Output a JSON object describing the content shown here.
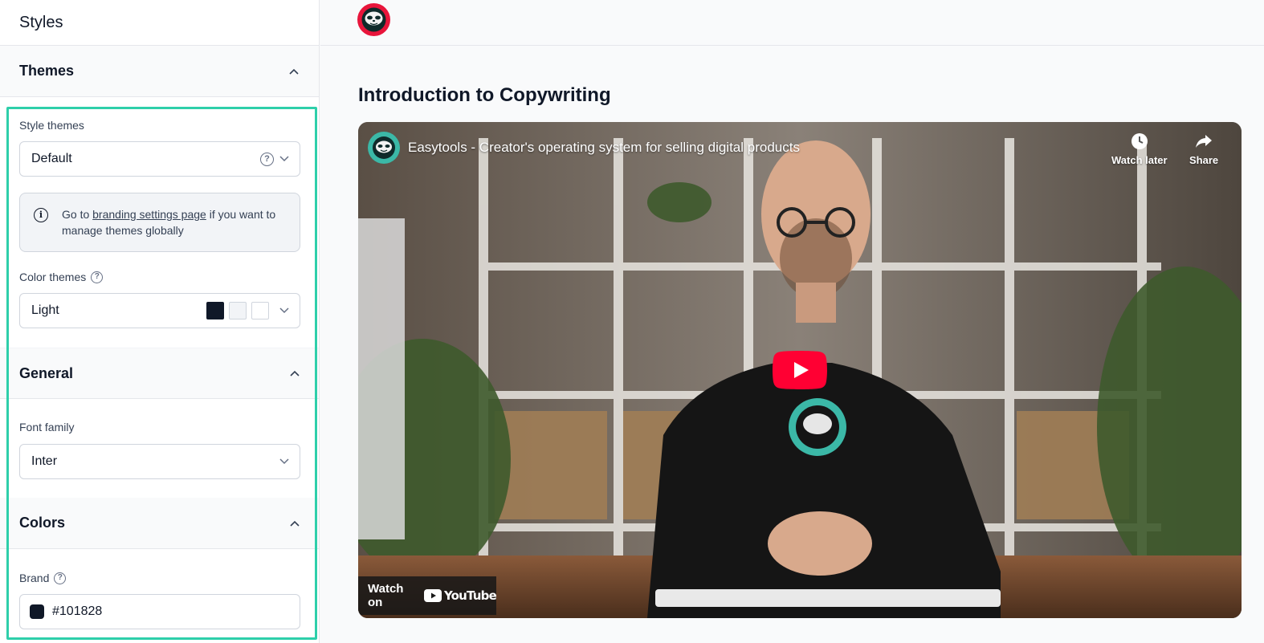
{
  "sidebar": {
    "title": "Styles",
    "themes": {
      "title": "Themes",
      "style_themes_label": "Style themes",
      "style_themes_value": "Default",
      "info_prefix": "Go to ",
      "info_link": "branding settings page",
      "info_suffix": " if you want to manage themes globally",
      "color_themes_label": "Color themes",
      "color_themes_value": "Light",
      "swatches": [
        "#101828",
        "#f2f4f7",
        "#ffffff"
      ]
    },
    "general": {
      "title": "General",
      "font_family_label": "Font family",
      "font_family_value": "Inter"
    },
    "colors": {
      "title": "Colors",
      "brand_label": "Brand",
      "brand_value": "#101828"
    }
  },
  "main": {
    "logo_color": "#e8153b",
    "page_title": "Introduction to Copywriting",
    "video": {
      "title": "Easytools - Creator's operating system for selling digital products",
      "watch_later": "Watch later",
      "share": "Share",
      "watch_on": "Watch on",
      "youtube": "YouTube"
    }
  },
  "colors": {
    "highlight": "#2ecfaa",
    "youtube_red": "#ff0033",
    "brand_teal": "#3bb8a7"
  }
}
